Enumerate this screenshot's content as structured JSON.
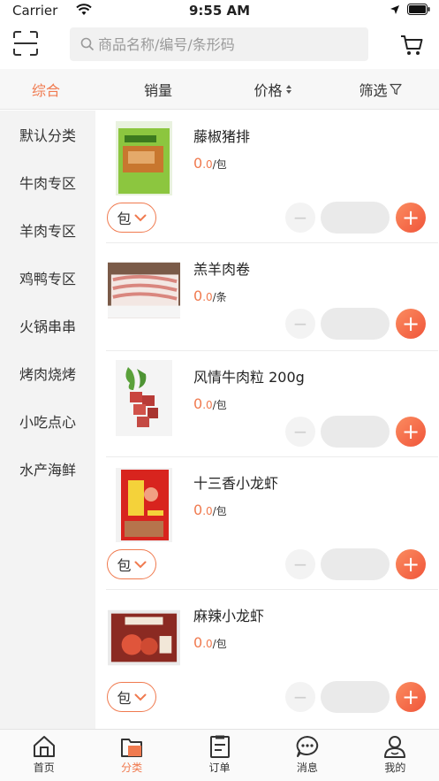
{
  "status_bar": {
    "carrier": "Carrier",
    "time": "9:55 AM"
  },
  "search": {
    "placeholder": "商品名称/编号/条形码"
  },
  "sort_bar": {
    "items": [
      "综合",
      "销量",
      "价格",
      "筛选"
    ],
    "active_index": 0
  },
  "categories": [
    "默认分类",
    "牛肉专区",
    "羊肉专区",
    "鸡鸭专区",
    "火锅串串",
    "烤肉烧烤",
    "小吃点心",
    "水产海鲜"
  ],
  "products": [
    {
      "name": "藤椒猪排",
      "price_int": "0",
      "price_dec": ".0",
      "unit": "/包",
      "unit_select": "包",
      "thumb": "green-package-icon"
    },
    {
      "name": "羔羊肉卷",
      "price_int": "0",
      "price_dec": ".0",
      "unit": "/条",
      "unit_select": "",
      "thumb": "meat-roll-icon"
    },
    {
      "name": "风情牛肉粒 200g",
      "price_int": "0",
      "price_dec": ".0",
      "unit": "/包",
      "unit_select": "",
      "thumb": "beef-cubes-icon"
    },
    {
      "name": "十三香小龙虾",
      "price_int": "0",
      "price_dec": ".0",
      "unit": "/包",
      "unit_select": "包",
      "thumb": "crayfish-package-icon"
    },
    {
      "name": "麻辣小龙虾",
      "price_int": "0",
      "price_dec": ".0",
      "unit": "/包",
      "unit_select": "包",
      "thumb": "crayfish-box-icon"
    }
  ],
  "tab_bar": {
    "items": [
      "首页",
      "分类",
      "订单",
      "消息",
      "我的"
    ],
    "active_index": 1
  },
  "colors": {
    "accent": "#f07a4f",
    "plus_gradient_start": "#fb8c60",
    "plus_gradient_end": "#f0553a"
  }
}
